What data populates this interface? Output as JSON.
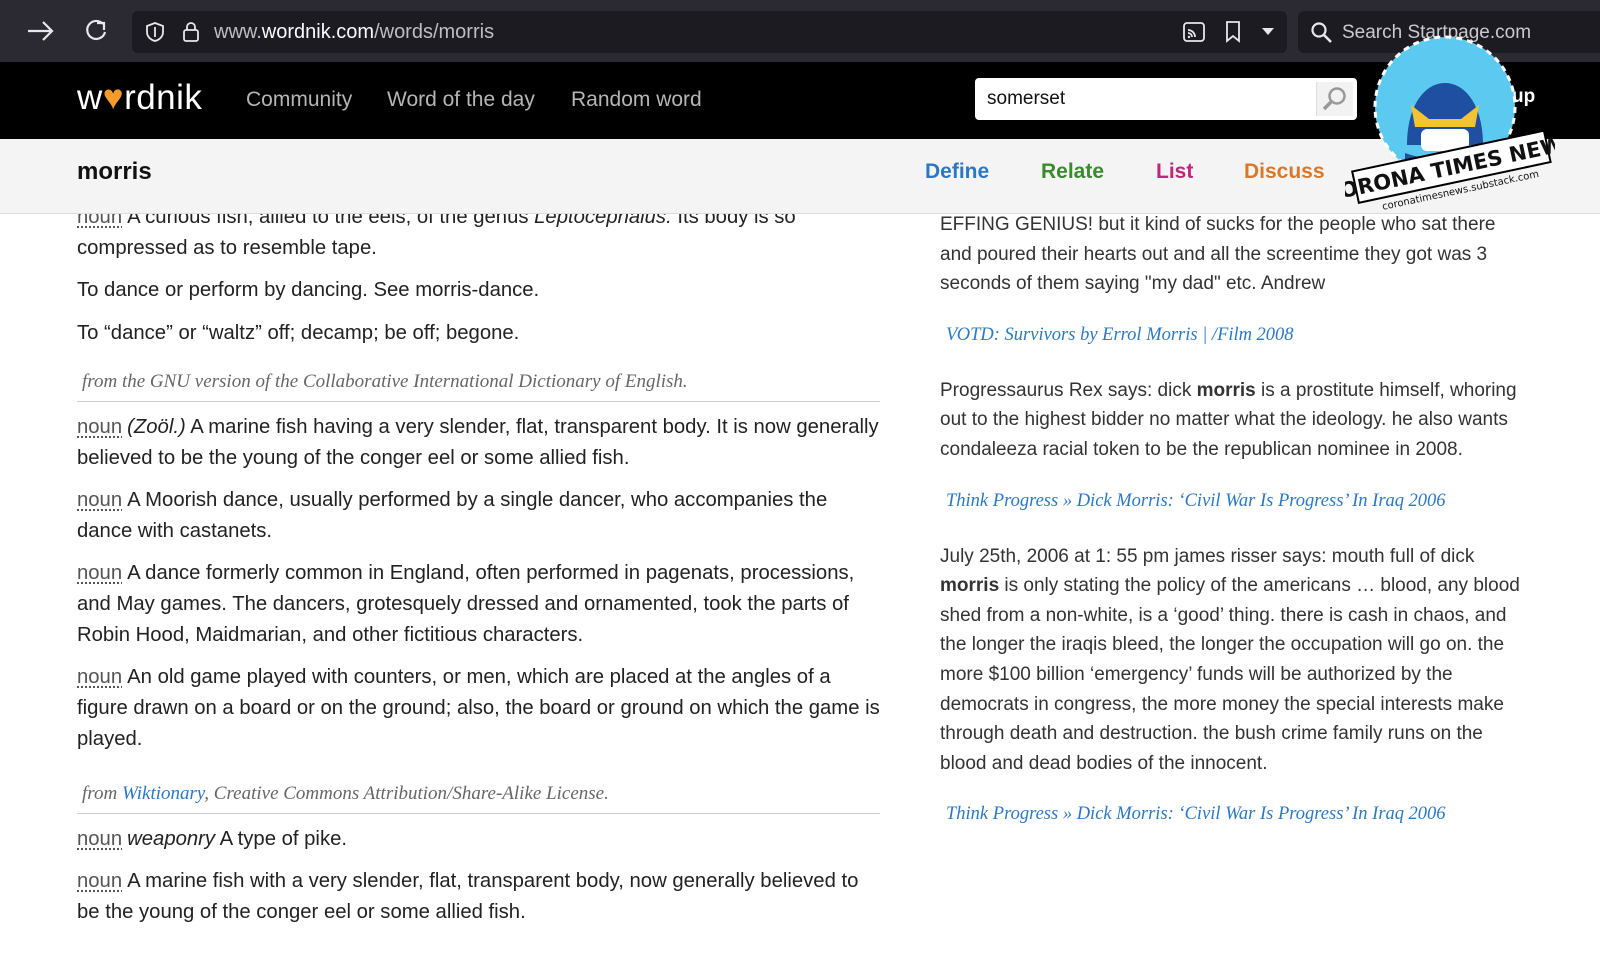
{
  "browser": {
    "url_prefix": "www.",
    "url_domain": "wordnik.com",
    "url_path": "/words/morris",
    "search_placeholder": "Search Startpage.com"
  },
  "header": {
    "logo": "wordnik",
    "nav": [
      "Community",
      "Word of the day",
      "Random word"
    ],
    "search_value": "somerset",
    "signup_label": "up"
  },
  "word": {
    "title": "morris",
    "tabs": [
      {
        "label": "Define",
        "color": "#2b78c5"
      },
      {
        "label": "Relate",
        "color": "#3a8a2e"
      },
      {
        "label": "List",
        "color": "#c0267c"
      },
      {
        "label": "Discuss",
        "color": "#d9782a"
      }
    ]
  },
  "definitions": {
    "d0": {
      "pos": "noun",
      "text_a": "A curious fish, allied to the eels, of the genus ",
      "genus": "Leptocephalus.",
      "text_b": " Its body is so compressed as to resemble tape."
    },
    "d1": "To dance or perform by dancing. See morris-dance.",
    "d2": "To “dance” or “waltz” off; decamp; be off; begone.",
    "attr1": "from the GNU version of the Collaborative International Dictionary of English.",
    "d3": {
      "pos": "noun",
      "label": "(Zoöl.)",
      "text": "A marine fish having a very slender, flat, transparent body. It is now generally believed to be the young of the conger eel or some allied fish."
    },
    "d4": {
      "pos": "noun",
      "text": "A Moorish dance, usually performed by a single dancer, who accompanies the dance with castanets."
    },
    "d5": {
      "pos": "noun",
      "text": "A dance formerly common in England, often performed in pagenats, processions, and May games. The dancers, grotesquely dressed and ornamented, took the parts of Robin Hood, Maidmarian, and other fictitious characters."
    },
    "d6": {
      "pos": "noun",
      "text": "An old game played with counters, or men, which are placed at the angles of a figure drawn on a board or on the ground; also, the board or ground on which the game is played."
    },
    "attr2_from": "from ",
    "attr2_link": "Wiktionary",
    "attr2_rest": ", Creative Commons Attribution/Share-Alike License.",
    "d7": {
      "pos": "noun",
      "label": "weaponry",
      "text": "A type of pike."
    },
    "d8": {
      "pos": "noun",
      "text": "A marine fish with a very slender, flat, transparent body, now generally believed to be the young of the conger eel or some allied fish."
    }
  },
  "examples": {
    "e0": "EFFING GENIUS! but it kind of sucks for the people who sat there and poured their hearts out and all the screentime they got was 3 seconds of them saying \"my dad\" etc. Andrew",
    "s0": {
      "title": "VOTD: Survivors by Errol Morris | /Film",
      "year": "2008"
    },
    "e1": {
      "a": "Progressaurus Rex says: dick ",
      "bold": "morris",
      "b": " is a prostitute himself, whoring out to the highest bidder no matter what the ideology. he also wants condaleeza racial token to be the republican nominee in 2008."
    },
    "s1": {
      "title": "Think Progress » Dick Morris: ‘Civil War Is Progress’ In Iraq",
      "year": "2006"
    },
    "e2": {
      "a": "July 25th, 2006 at 1: 55 pm james risser says: mouth full of dick ",
      "bold": "morris",
      "b": " is only stating the policy of the americans … blood, any blood shed from a non-white, is a ‘good’ thing. there is cash in chaos, and the longer the iraqis bleed, the longer the occupation will go on. the more $100 billion ‘emergency’ funds will be authorized by the democrats in congress, the more money the special interests make through death and destruction. the bush crime family runs on the blood and dead bodies of the innocent."
    },
    "s2": {
      "title": "Think Progress » Dick Morris: ‘Civil War Is Progress’ In Iraq",
      "year": "2006"
    }
  },
  "watermark": {
    "title": "CORONA TIMES NEWS",
    "url": "coronatimesnews.substack.com"
  }
}
